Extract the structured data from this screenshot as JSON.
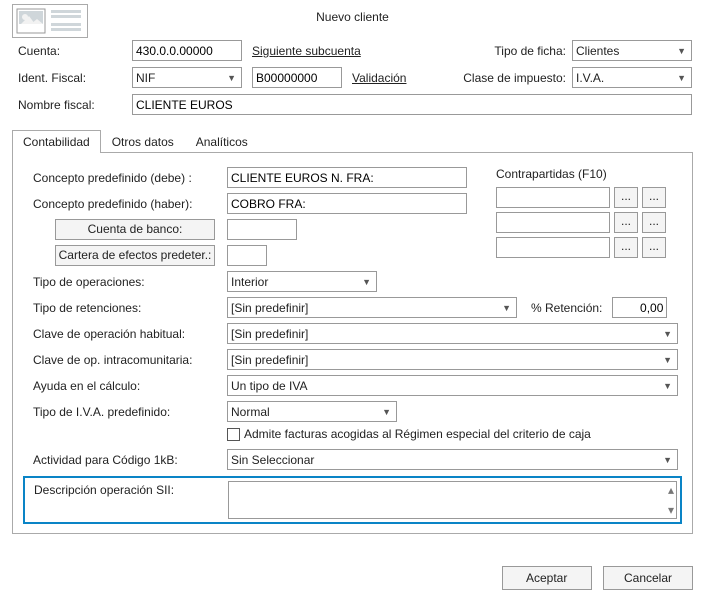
{
  "title": "Nuevo cliente",
  "header": {
    "cuenta_label": "Cuenta:",
    "cuenta_value": "430.0.0.00000",
    "siguiente_subcuenta": "Siguiente subcuenta",
    "tipo_ficha_label": "Tipo de ficha:",
    "tipo_ficha_value": "Clientes",
    "ident_fiscal_label": "Ident. Fiscal:",
    "ident_fiscal_type": "NIF",
    "ident_fiscal_value": "B00000000",
    "validacion": "Validación",
    "clase_impuesto_label": "Clase de impuesto:",
    "clase_impuesto_value": "I.V.A.",
    "nombre_fiscal_label": "Nombre fiscal:",
    "nombre_fiscal_value": "CLIENTE EUROS"
  },
  "tabs": {
    "contabilidad": "Contabilidad",
    "otros_datos": "Otros datos",
    "analiticos": "Analíticos"
  },
  "panel": {
    "concepto_debe_label": "Concepto predefinido (debe) :",
    "concepto_debe_value": "CLIENTE EUROS N. FRA:",
    "concepto_haber_label": "Concepto predefinido (haber):",
    "concepto_haber_value": "COBRO FRA:",
    "cuenta_banco_btn": "Cuenta de banco:",
    "cartera_btn": "Cartera de efectos predeter.:",
    "contrapartidas_title": "Contrapartidas (F10)",
    "tipo_operaciones_label": "Tipo de operaciones:",
    "tipo_operaciones_value": "Interior",
    "tipo_retenciones_label": "Tipo de retenciones:",
    "tipo_retenciones_value": "[Sin predefinir]",
    "pct_retencion_label": "% Retención:",
    "pct_retencion_value": "0,00",
    "clave_op_habitual_label": "Clave de operación habitual:",
    "clave_op_habitual_value": "[Sin predefinir]",
    "clave_op_intra_label": "Clave de op. intracomunitaria:",
    "clave_op_intra_value": "[Sin predefinir]",
    "ayuda_calculo_label": "Ayuda en el cálculo:",
    "ayuda_calculo_value": "Un tipo de IVA",
    "tipo_iva_label": "Tipo de I.V.A. predefinido:",
    "tipo_iva_value": "Normal",
    "admite_facturas_label": "Admite facturas acogidas al Régimen especial del criterio de caja",
    "actividad_label": "Actividad para Código 1kB:",
    "actividad_value": "Sin Seleccionar",
    "descripcion_sii_label": "Descripción operación SII:",
    "ellipsis": "..."
  },
  "footer": {
    "aceptar": "Aceptar",
    "cancelar": "Cancelar"
  }
}
